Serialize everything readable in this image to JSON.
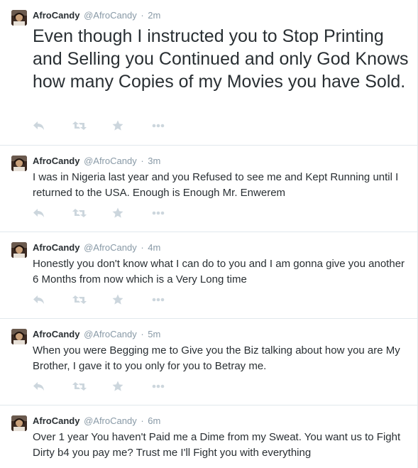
{
  "colors": {
    "text": "#292f33",
    "muted": "#8899a6",
    "action_icon": "#ccd6dd",
    "divider": "#e1e8ed"
  },
  "icons": {
    "reply": "reply-icon",
    "retweet": "retweet-icon",
    "favorite": "star-icon",
    "more": "more-icon"
  },
  "tweets": [
    {
      "name": "AfroCandy",
      "handle": "@AfroCandy",
      "separator": "·",
      "time": "2m",
      "text": "Even though I instructed you to Stop Printing and Selling you Continued and only God Knows how many Copies of my Movies you have Sold."
    },
    {
      "name": "AfroCandy",
      "handle": "@AfroCandy",
      "separator": "·",
      "time": "3m",
      "text": "I was in Nigeria last year and you Refused to see me and Kept Running until I returned to the USA. Enough is Enough Mr. Enwerem"
    },
    {
      "name": "AfroCandy",
      "handle": "@AfroCandy",
      "separator": "·",
      "time": "4m",
      "text": "Honestly you don't know what I can do to you and I am gonna give you another 6 Months from now which is a Very Long time"
    },
    {
      "name": "AfroCandy",
      "handle": "@AfroCandy",
      "separator": "·",
      "time": "5m",
      "text": "When you were Begging me to Give you the Biz talking about how you are My Brother, I gave it to you only for you to Betray me."
    },
    {
      "name": "AfroCandy",
      "handle": "@AfroCandy",
      "separator": "·",
      "time": "6m",
      "text": "Over 1 year You haven't Paid me a Dime from my Sweat. You want us to Fight Dirty b4 you pay me? Trust me I'll Fight you with everything"
    }
  ]
}
